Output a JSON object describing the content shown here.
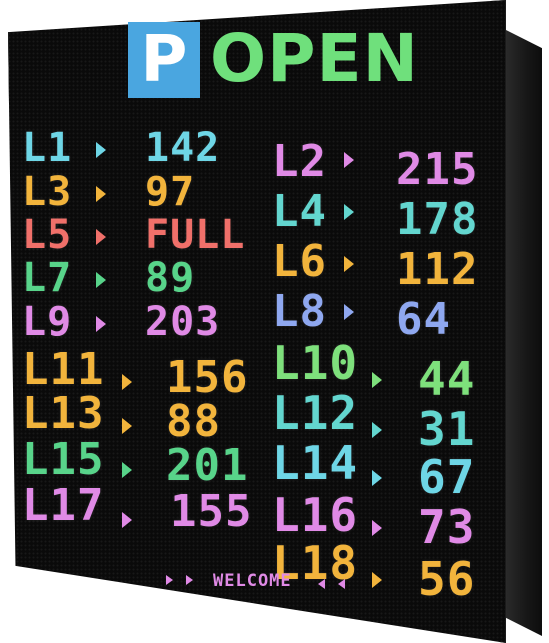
{
  "header": {
    "badge_letter": "P",
    "status": "OPEN",
    "badge_color": "#4aa6e0",
    "status_color": "#6fe07c"
  },
  "levels": [
    {
      "label": "L1",
      "count": "142",
      "color": "#6ed6e6"
    },
    {
      "label": "L2",
      "count": "215",
      "color": "#e08ae6"
    },
    {
      "label": "L3",
      "count": "97",
      "color": "#f2b43c"
    },
    {
      "label": "L4",
      "count": "178",
      "color": "#63d6cf"
    },
    {
      "label": "L5",
      "count": "FULL",
      "color": "#f0706a"
    },
    {
      "label": "L6",
      "count": "112",
      "color": "#f2b43c"
    },
    {
      "label": "L7",
      "count": "89",
      "color": "#58d48a"
    },
    {
      "label": "L8",
      "count": "64",
      "color": "#8fa8f0"
    },
    {
      "label": "L9",
      "count": "203",
      "color": "#e08ae6"
    },
    {
      "label": "L10",
      "count": "44",
      "color": "#7ee07c"
    },
    {
      "label": "L11",
      "count": "156",
      "color": "#f2b43c"
    },
    {
      "label": "L12",
      "count": "31",
      "color": "#63d6cf"
    },
    {
      "label": "L13",
      "count": "88",
      "color": "#f2b43c"
    },
    {
      "label": "L14",
      "count": "67",
      "color": "#6ed6e6"
    },
    {
      "label": "L15",
      "count": "201",
      "color": "#58d48a"
    },
    {
      "label": "L16",
      "count": "73",
      "color": "#e08ae6"
    },
    {
      "label": "L17",
      "count": "155",
      "color": "#e08ae6"
    },
    {
      "label": "L18",
      "count": "56",
      "color": "#f2b43c"
    }
  ],
  "footer": {
    "message": "WELCOME",
    "color": "#e08ae6"
  },
  "icons": {
    "arrow": "triangle-right",
    "footer_left": "double-triangle-right",
    "footer_right": "double-triangle-left"
  }
}
